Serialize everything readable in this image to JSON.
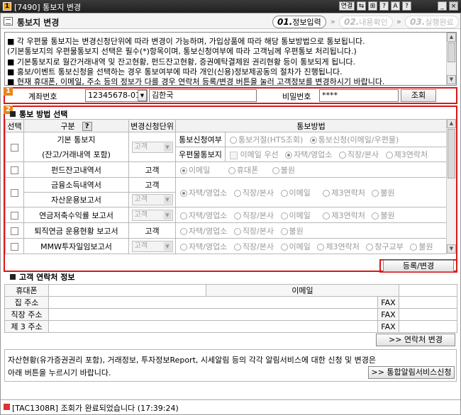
{
  "window": {
    "badge": "1",
    "title": "[7490] 통보지 변경",
    "buttons": [
      "연결",
      "⇆",
      "⊞",
      "?",
      "A",
      "?",
      "_",
      "×"
    ]
  },
  "header": {
    "title": "통보지 변경",
    "steps": [
      {
        "num": "01.",
        "label": "정보입력"
      },
      {
        "num": "02.",
        "label": "내용확인"
      },
      {
        "num": "03.",
        "label": "실행완료"
      }
    ]
  },
  "notice": [
    "■ 각 우편물 통보지는 변경신청단위에 따라 변경이 가능하며, 가입상품에 따라 해당 통보방법으로 통보됩니다.",
    "  (기본통보지의 우편물통보지 선택은 필수(*)항목이며, 통보신청여부에 따라 고객님께 우편통보 처리됩니다.)",
    "■ 기본통보지로 월간거래내역 및 잔고현황, 펀드잔고현황, 증권예탁결제원 권리현황 등이 통보되게 됩니다.",
    "■ 홍보/이벤트 통보신청을 선택하는 경우 통보여부에 따라 개인(신용)정보제공동의 절차가 진행됩니다.",
    "■ 현재 휴대폰, 이메일, 주소 등의 정보가 다를 경우 연락처 등록/변경 버튼을 눌러 고객정보를 변경하시기 바랍니다."
  ],
  "account": {
    "badge": "1",
    "label": "계좌번호",
    "number": "12345678-01",
    "name": "김한국",
    "password_label": "비밀번호",
    "password": "****",
    "query_button": "조회"
  },
  "method": {
    "badge": "2",
    "title": "통보 방법 선택",
    "headers": {
      "select": "선택",
      "category": "구분",
      "unit": "변경신청단위",
      "method": "통보방법"
    },
    "basic": {
      "line1": "기본 통보지",
      "line2": "(잔고/거래내역 포함)",
      "unit": "고객",
      "sub1_label": "통보신청여부",
      "sub1_options": [
        "통보거절(HTS조회)",
        "통보신청(이메일/우편물)"
      ],
      "sub2_label": "우편물통보지",
      "sub2_check": "이메일 우선",
      "sub2_options": [
        "자택/영업소",
        "직장/본사",
        "제3연락처"
      ]
    },
    "rows": [
      {
        "label": "펀드잔고내역서",
        "unit": "고객",
        "options": [
          "이메일",
          "휴대폰",
          "불원"
        ]
      },
      {
        "label": "금융소득내역서",
        "unit": "고객",
        "options": [
          "자택/영업소",
          "직장/본사",
          "이메일",
          "제3연락처",
          "불원"
        ]
      },
      {
        "label": "자산운용보고서",
        "unit": "고객"
      },
      {
        "label": "연금저축수익률 보고서",
        "unit": "고객",
        "options": [
          "자택/영업소",
          "직장/본사",
          "이메일",
          "제3연락처",
          "불원"
        ]
      },
      {
        "label": "퇴직연금 운용현황 보고서",
        "unit": "고객",
        "options": [
          "자택/영업소",
          "직장/본사",
          "불원"
        ]
      },
      {
        "label": "MMW투자일임보고서",
        "unit": "고객",
        "options": [
          "자택/영업소",
          "직장/본사",
          "이메일",
          "제3연락처",
          "창구교부",
          "불원"
        ]
      }
    ],
    "register_button": "등록/변경"
  },
  "contact": {
    "title": "고객 연락처 정보",
    "rows": [
      "휴대폰",
      "집 주소",
      "직장 주소",
      "제 3 주소"
    ],
    "email_label": "이메일",
    "fax_label": "FAX",
    "change_button": ">> 연락처 변경"
  },
  "footer": {
    "line1": "자산현황(유가증권권리 포함), 거래정보, 투자정보Report, 시세알림 등의 각각 알림서비스에 대한 신청 및 변경은",
    "line2": "아래 버튼을 누르시기 바랍니다.",
    "button": ">> 통합알림서비스신청"
  },
  "status": {
    "message": "[TAC1308R] 조회가 완료되었습니다 (17:39:24)"
  }
}
